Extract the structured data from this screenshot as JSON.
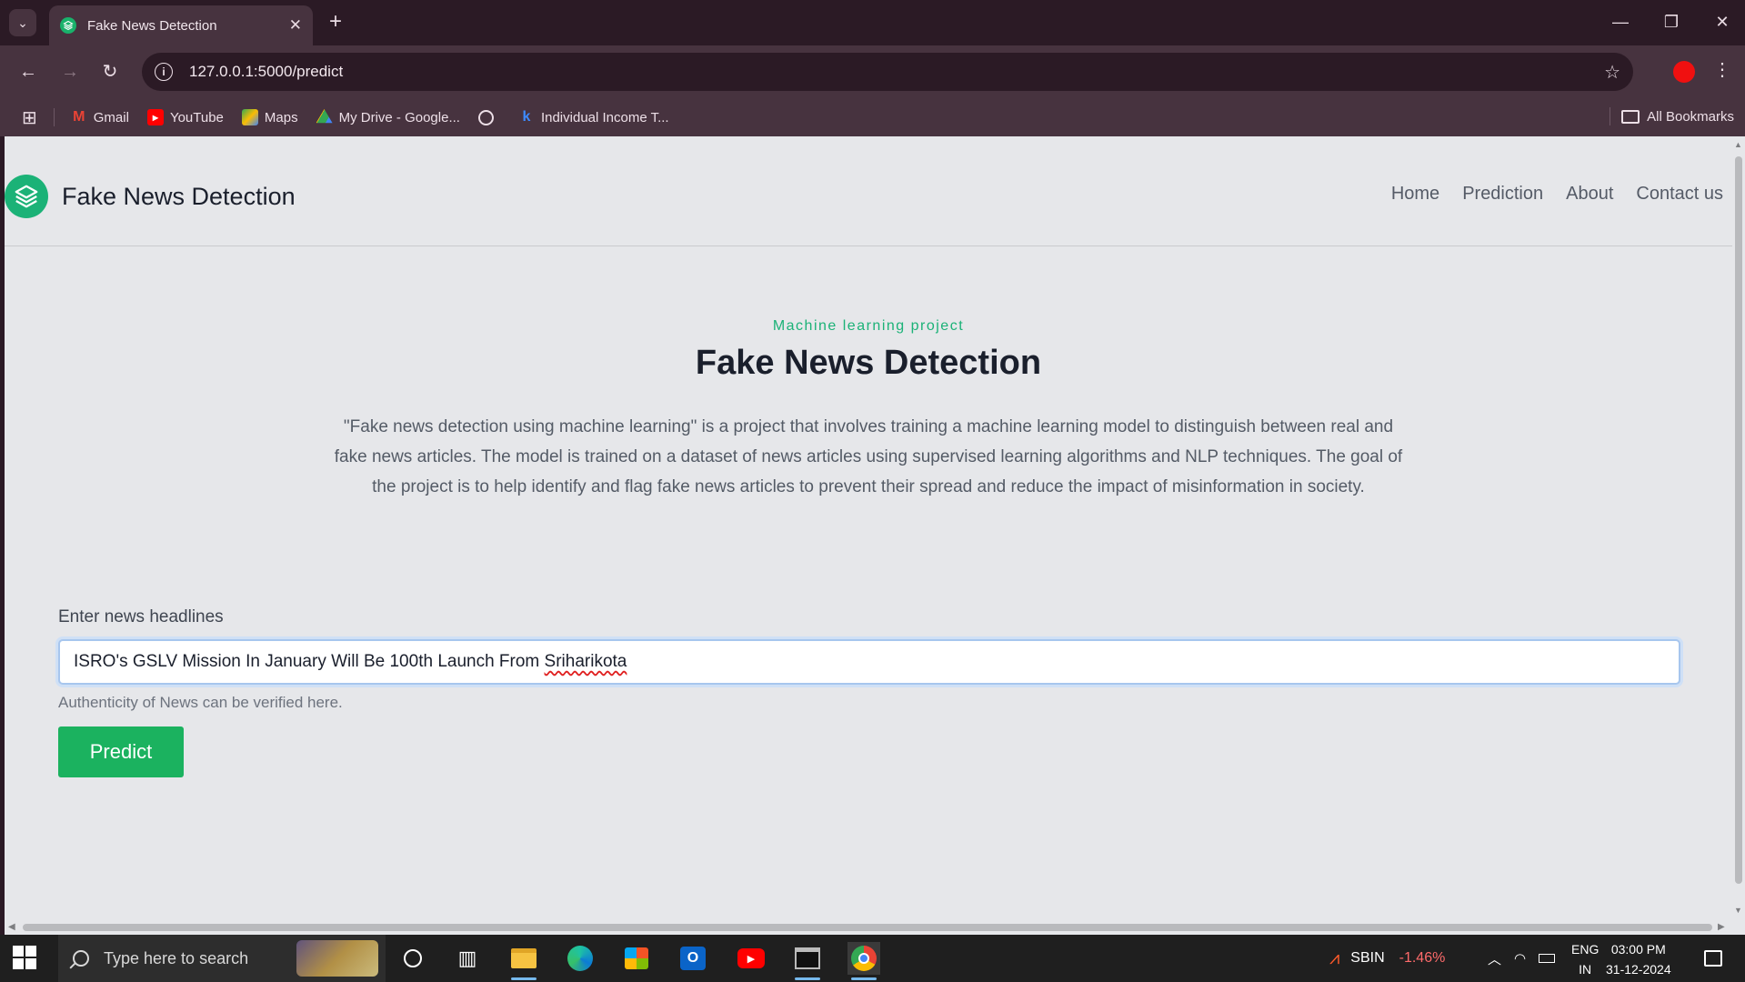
{
  "browser": {
    "tab_title": "Fake News Detection",
    "url": "127.0.0.1:5000/predict",
    "bookmarks": [
      {
        "label": "Gmail",
        "icon": "gmail-icon"
      },
      {
        "label": "YouTube",
        "icon": "youtube-icon"
      },
      {
        "label": "Maps",
        "icon": "maps-icon"
      },
      {
        "label": "My Drive - Google...",
        "icon": "drive-icon"
      },
      {
        "label": "",
        "icon": "globe-icon"
      },
      {
        "label": "Individual Income T...",
        "icon": "k-icon"
      }
    ],
    "all_bookmarks": "All Bookmarks"
  },
  "site": {
    "brand": "Fake News Detection",
    "nav": [
      "Home",
      "Prediction",
      "About",
      "Contact us"
    ],
    "eyebrow": "Machine learning project",
    "title": "Fake News Detection",
    "description": "\"Fake news detection using machine learning\" is a project that involves training a machine learning model to distinguish between real and fake news articles. The model is trained on a dataset of news articles using supervised learning algorithms and NLP techniques. The goal of the project is to help identify and flag fake news articles to prevent their spread and reduce the impact of misinformation in society.",
    "form": {
      "label": "Enter news headlines",
      "value_start": "ISRO's GSLV Mission In January Will Be 100th Launch From ",
      "value_misspelled": "Sriharikota",
      "help": "Authenticity of News can be verified here.",
      "button": "Predict"
    }
  },
  "taskbar": {
    "search_placeholder": "Type here to search",
    "stock_symbol": "SBIN",
    "stock_change": "-1.46%",
    "lang_line1": "ENG",
    "lang_line2": "IN",
    "time": "03:00 PM",
    "date": "31-12-2024"
  },
  "colors": {
    "accent": "#1bb277",
    "button": "#1bb25f",
    "stock_down": "#ff6b6b"
  }
}
